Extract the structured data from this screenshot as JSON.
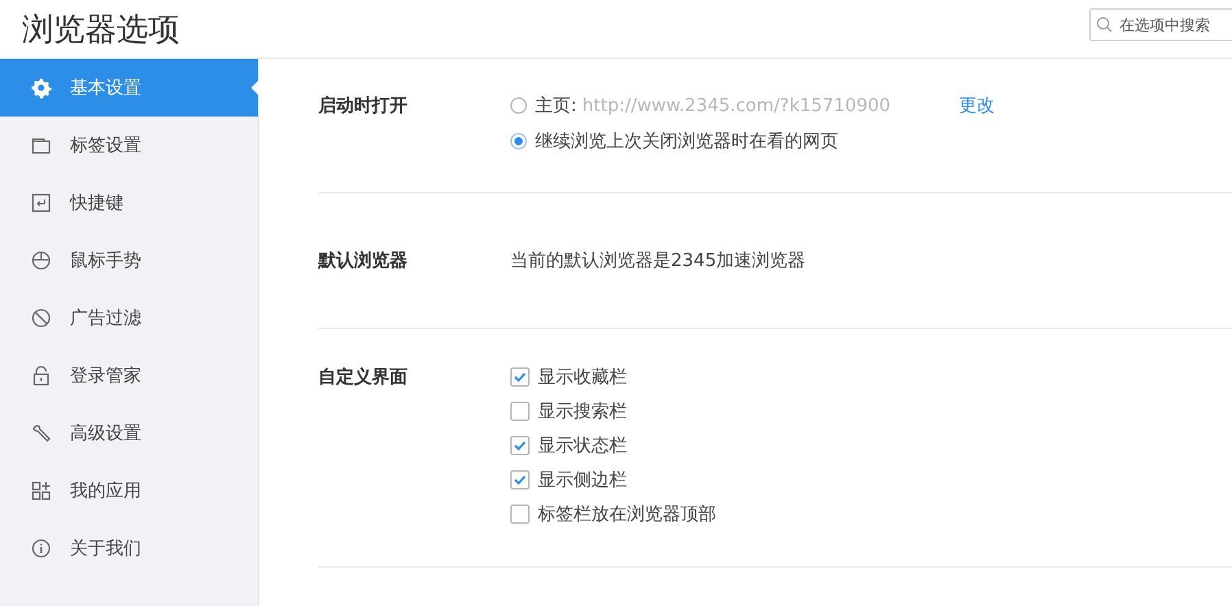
{
  "window": {
    "title": "浏览器选项"
  },
  "search": {
    "placeholder": "在选项中搜索"
  },
  "sidebar": {
    "items": [
      {
        "label": "基本设置",
        "kind": "gear",
        "selected": true
      },
      {
        "label": "标签设置",
        "kind": "tab",
        "selected": false
      },
      {
        "label": "快捷键",
        "kind": "key",
        "selected": false
      },
      {
        "label": "鼠标手势",
        "kind": "mouse",
        "selected": false
      },
      {
        "label": "广告过滤",
        "kind": "ban",
        "selected": false
      },
      {
        "label": "登录管家",
        "kind": "lock",
        "selected": false
      },
      {
        "label": "高级设置",
        "kind": "wrench",
        "selected": false
      },
      {
        "label": "我的应用",
        "kind": "apps",
        "selected": false
      },
      {
        "label": "关于我们",
        "kind": "info",
        "selected": false
      }
    ]
  },
  "sections": [
    {
      "kind": "radio",
      "label": "启动时打开",
      "options": [
        {
          "label": "主页:",
          "value": "http://www.2345.com/?k15710900",
          "link": "更改",
          "selected": false
        },
        {
          "label": "继续浏览上次关闭浏览器时在看的网页",
          "selected": true
        }
      ]
    },
    {
      "kind": "text",
      "label": "默认浏览器",
      "text": "当前的默认浏览器是2345加速浏览器"
    },
    {
      "kind": "checkbox",
      "label": "自定义界面",
      "options": [
        {
          "label": "显示收藏栏",
          "checked": true
        },
        {
          "label": "显示搜索栏",
          "checked": false
        },
        {
          "label": "显示状态栏",
          "checked": true
        },
        {
          "label": "显示侧边栏",
          "checked": true
        },
        {
          "label": "标签栏放在浏览器顶部",
          "checked": false
        }
      ]
    }
  ]
}
